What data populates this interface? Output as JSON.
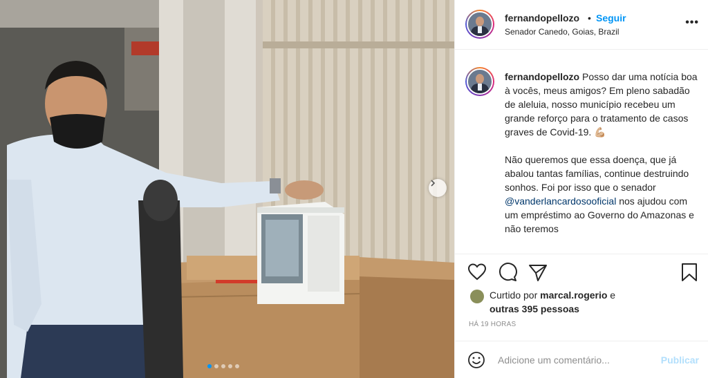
{
  "post": {
    "username": "fernandopellozo",
    "separator": "•",
    "follow_label": "Seguir",
    "location": "Senador Canedo, Goias, Brazil",
    "more_label": "•••",
    "caption": {
      "username": "fernandopellozo",
      "part1": "Posso dar uma notícia boa à vocês, meus amigos? Em pleno sabadão de aleluia, nosso município recebeu um grande reforço para o tratamento de casos graves de Covid-19. 💪🏼",
      "part2a": "Não queremos que essa doença, que já abalou tantas famílias, continue destruindo sonhos. Foi por isso que o senador ",
      "mention": "@vanderlancardosooficial",
      "part2b": " nos ajudou com um empréstimo ao Governo do Amazonas e não teremos"
    },
    "likes": {
      "prefix": "Curtido por ",
      "user": "marcal.rogerio",
      "middle": " e ",
      "others": "outras 395 pessoas"
    },
    "time": "HÁ 19 HORAS",
    "comment_placeholder": "Adicione um comentário...",
    "publish_label": "Publicar"
  },
  "carousel": {
    "count": 5,
    "active_index": 0
  },
  "icons": [
    "heart-icon",
    "comment-icon",
    "share-icon",
    "bookmark-icon",
    "emoji-icon",
    "chevron-right-icon",
    "more-icon"
  ],
  "colors": {
    "accent": "#0095f6",
    "publish_disabled": "#b2dffc",
    "mention": "#00376b",
    "secondary_text": "#8e8e8e"
  }
}
